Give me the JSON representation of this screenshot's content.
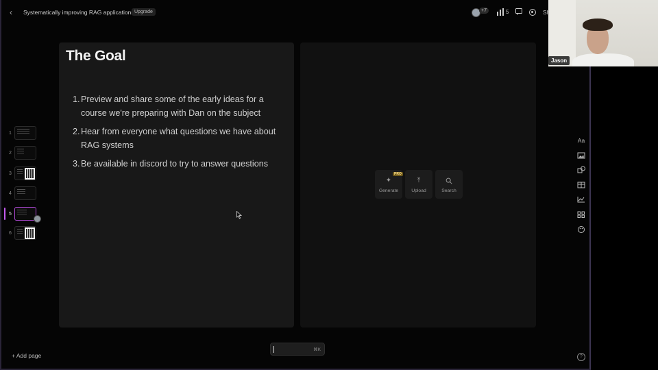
{
  "header": {
    "title": "Systematically improving RAG applications",
    "upgrade_label": "Upgrade",
    "collaborators_extra": "+7",
    "view_count": "5",
    "share_label": "Sh"
  },
  "sidebar": {
    "pages": [
      {
        "number": "1"
      },
      {
        "number": "2"
      },
      {
        "number": "3"
      },
      {
        "number": "4"
      },
      {
        "number": "5"
      },
      {
        "number": "6"
      }
    ],
    "active_page": "5",
    "add_page_label": "+ Add page"
  },
  "slide": {
    "title": "The Goal",
    "goals": [
      {
        "n": "1.",
        "text": "Preview and share some of the early ideas for a course we're preparing with Dan on the subject"
      },
      {
        "n": "2.",
        "text": "Hear from everyone what questions we have about RAG systems"
      },
      {
        "n": "3.",
        "text": "Be available in discord to try to answer questions"
      }
    ]
  },
  "media_tools": {
    "generate_label": "Generate",
    "pro_badge": "PRO",
    "upload_label": "Upload",
    "search_label": "Search"
  },
  "right_toolbar": {
    "text_label": "Aa"
  },
  "command_bar": {
    "shortcut": "⌘K"
  },
  "video": {
    "participant_name": "Jason"
  },
  "colors": {
    "accent": "#c45bf0",
    "background": "#050505",
    "card": "#181818"
  }
}
